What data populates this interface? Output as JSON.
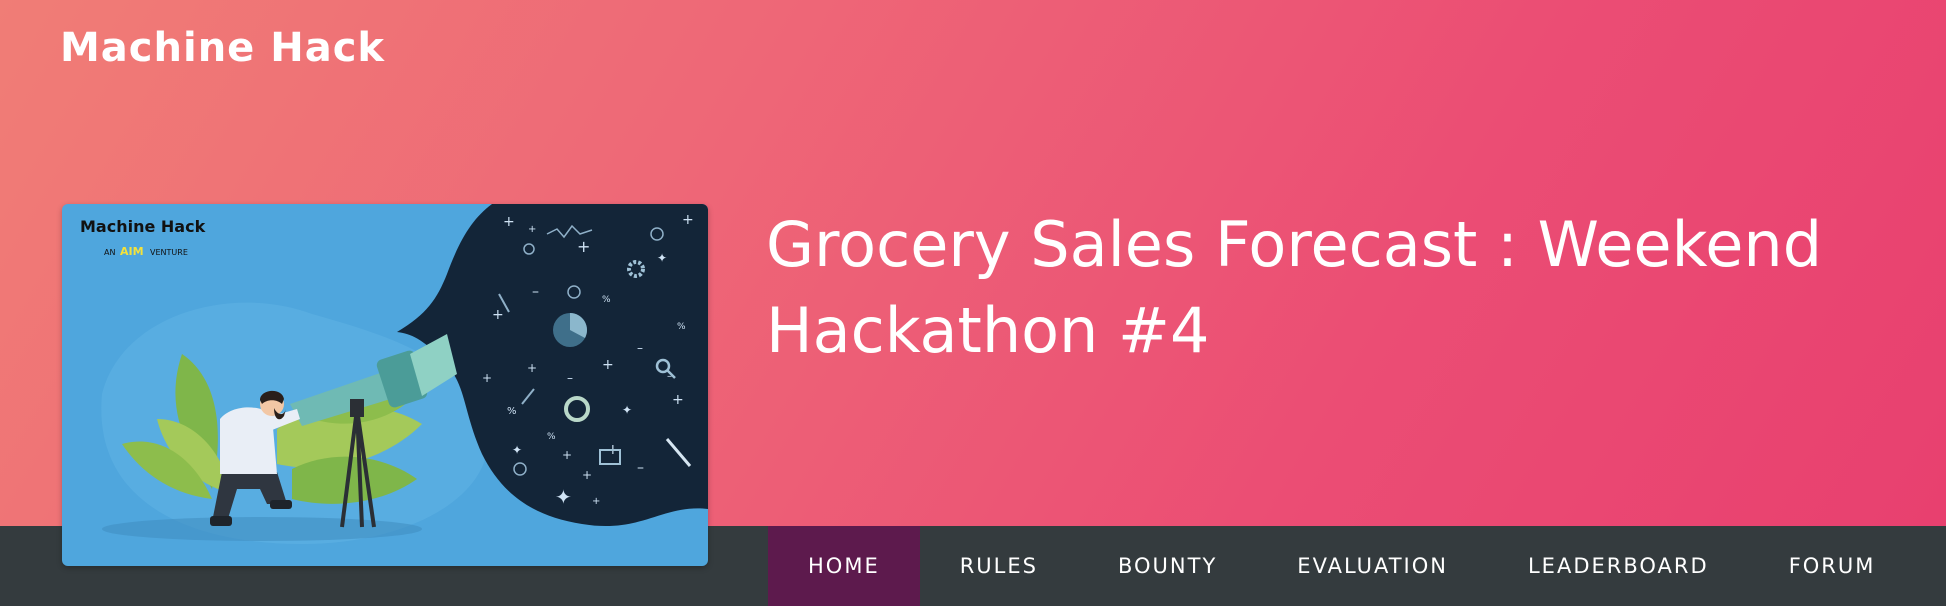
{
  "brand": {
    "logo_text": "Machine Hack"
  },
  "page": {
    "title": "Grocery Sales Forecast : Weekend Hackathon #4"
  },
  "banner": {
    "logo_text": "Machine Hack",
    "sub_prefix": "AN",
    "sub_brand": "AIM",
    "sub_suffix": "VENTURE"
  },
  "nav": {
    "items": [
      {
        "label": "HOME",
        "active": true
      },
      {
        "label": "RULES",
        "active": false
      },
      {
        "label": "BOUNTY",
        "active": false
      },
      {
        "label": "EVALUATION",
        "active": false
      },
      {
        "label": "LEADERBOARD",
        "active": false
      },
      {
        "label": "FORUM",
        "active": false
      }
    ]
  },
  "colors": {
    "hero_start": "#f07d76",
    "hero_end": "#e8406f",
    "navbar_bg": "#343b3e",
    "nav_active_bg": "#5d1a4d",
    "banner_blue": "#4fa6dd",
    "banner_night": "#132538"
  }
}
